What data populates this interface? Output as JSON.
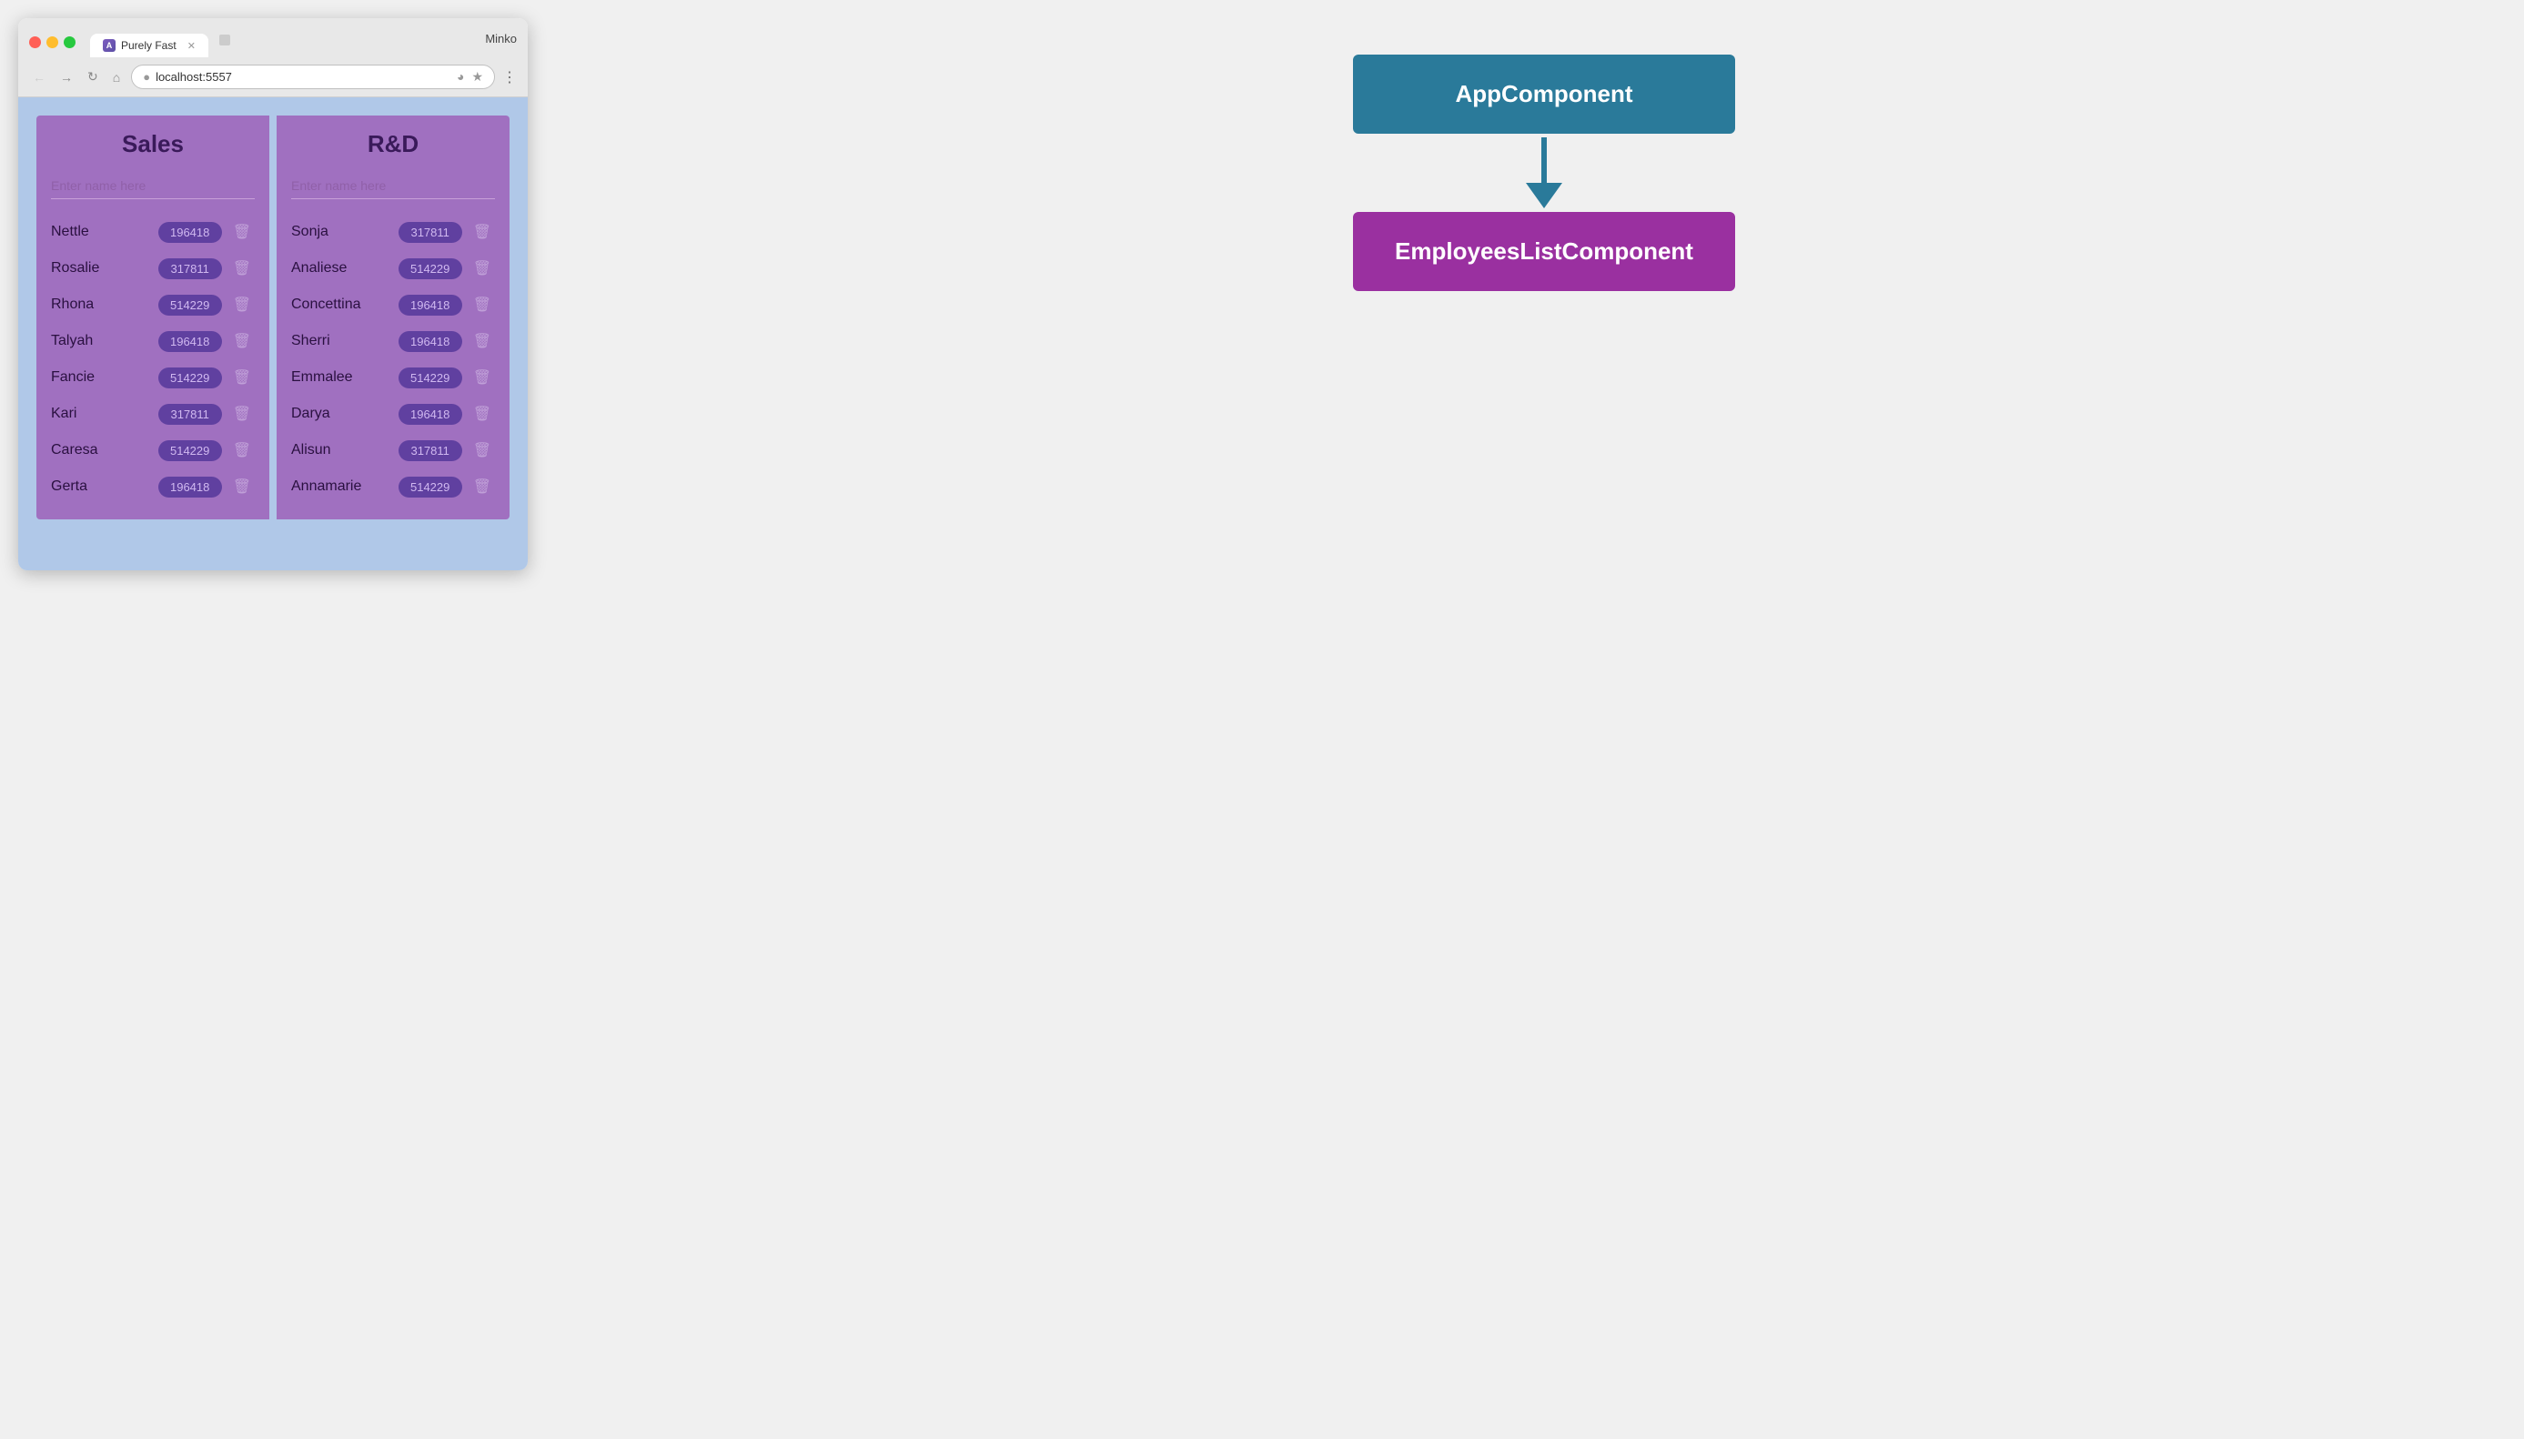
{
  "browser": {
    "tab_title": "Purely Fast",
    "url": "localhost:5557",
    "user": "Minko",
    "tab_icon_letter": "A"
  },
  "app": {
    "departments": [
      {
        "id": "sales",
        "title": "Sales",
        "input_placeholder": "Enter name here",
        "employees": [
          {
            "name": "Nettle",
            "badge": "196418"
          },
          {
            "name": "Rosalie",
            "badge": "317811"
          },
          {
            "name": "Rhona",
            "badge": "514229"
          },
          {
            "name": "Talyah",
            "badge": "196418"
          },
          {
            "name": "Fancie",
            "badge": "514229"
          },
          {
            "name": "Kari",
            "badge": "317811"
          },
          {
            "name": "Caresa",
            "badge": "514229"
          },
          {
            "name": "Gerta",
            "badge": "196418"
          }
        ]
      },
      {
        "id": "rnd",
        "title": "R&D",
        "input_placeholder": "Enter name here",
        "employees": [
          {
            "name": "Sonja",
            "badge": "317811"
          },
          {
            "name": "Analiese",
            "badge": "514229"
          },
          {
            "name": "Concettina",
            "badge": "196418"
          },
          {
            "name": "Sherri",
            "badge": "196418"
          },
          {
            "name": "Emmalee",
            "badge": "514229"
          },
          {
            "name": "Darya",
            "badge": "196418"
          },
          {
            "name": "Alisun",
            "badge": "317811"
          },
          {
            "name": "Annamarie",
            "badge": "514229"
          }
        ]
      }
    ]
  },
  "diagram": {
    "app_component_label": "AppComponent",
    "employees_component_label": "EmployeesListComponent"
  }
}
